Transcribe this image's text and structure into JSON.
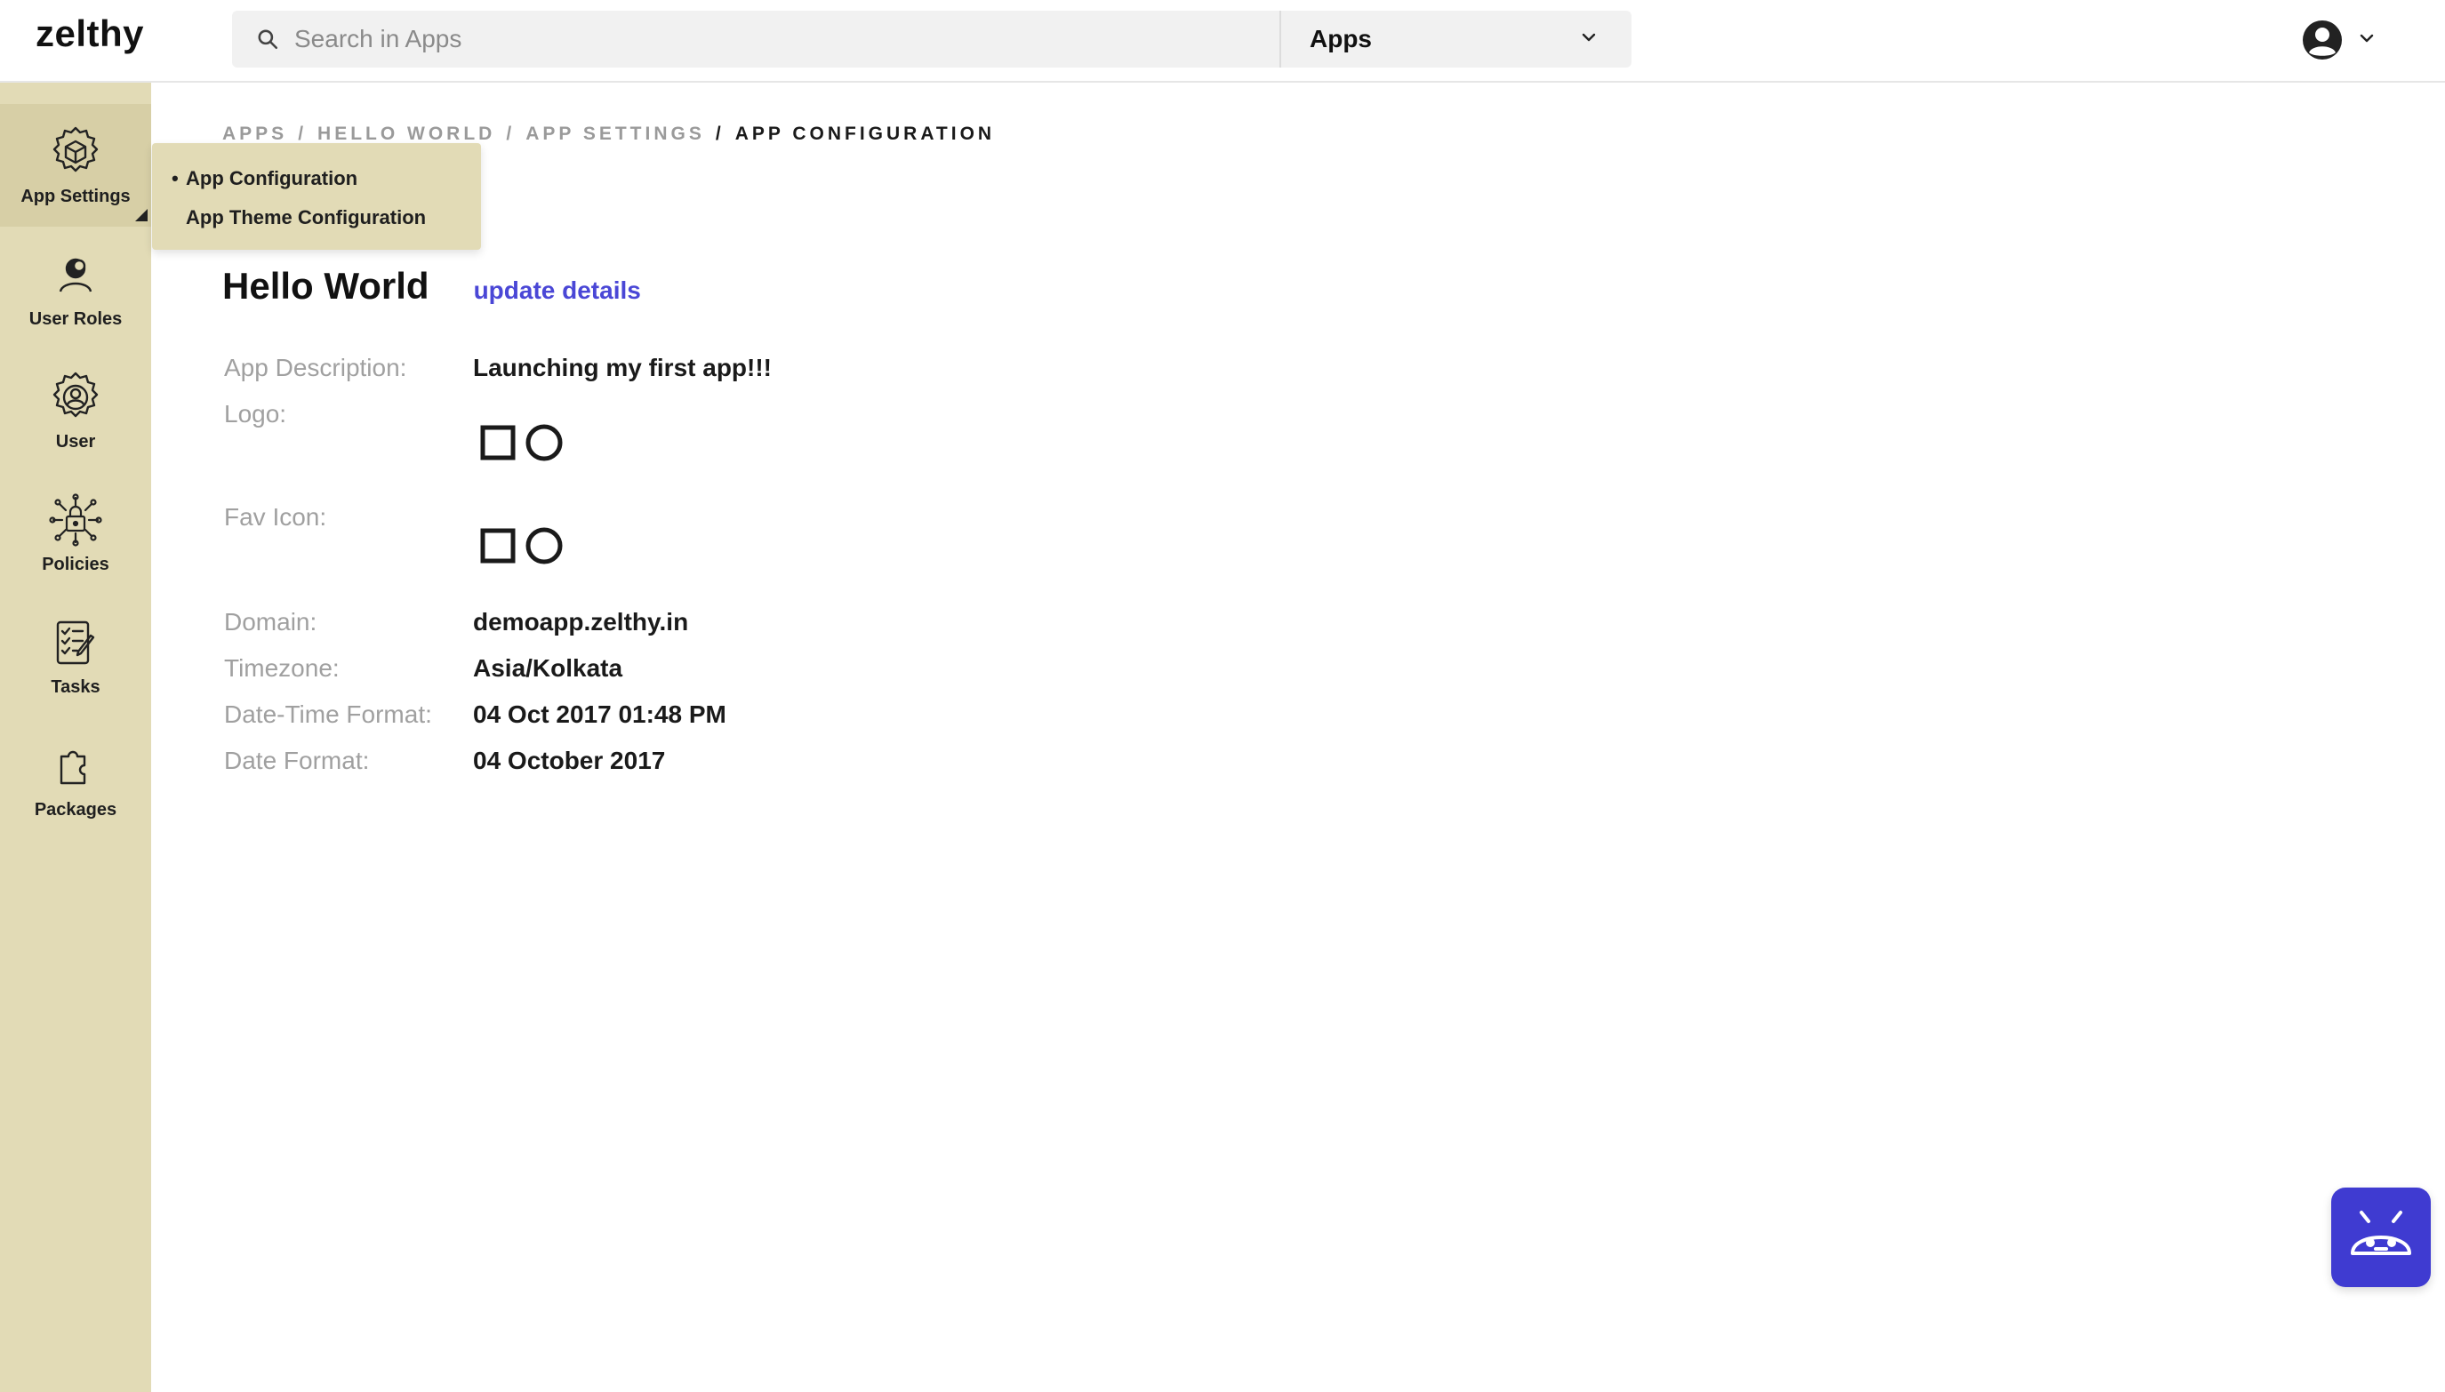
{
  "header": {
    "logo": "zelthy",
    "search": {
      "placeholder": "Search in Apps",
      "value": ""
    },
    "scope_select": {
      "selected": "Apps"
    }
  },
  "sidebar": {
    "items": [
      {
        "label": "App Settings",
        "icon": "cube-gear-icon",
        "active": true
      },
      {
        "label": "User Roles",
        "icon": "user-roles-icon"
      },
      {
        "label": "User",
        "icon": "gear-icon"
      },
      {
        "label": "Policies",
        "icon": "policy-lock-icon"
      },
      {
        "label": "Tasks",
        "icon": "checklist-icon"
      },
      {
        "label": "Packages",
        "icon": "puzzle-icon"
      }
    ]
  },
  "flyout": {
    "items": [
      {
        "label": "App Configuration",
        "active": true
      },
      {
        "label": "App Theme Configuration"
      }
    ]
  },
  "breadcrumb": {
    "items": [
      "APPS",
      "HELLO WORLD",
      "APP SETTINGS"
    ],
    "current": "APP CONFIGURATION",
    "separator": "/"
  },
  "page": {
    "title": "Hello World",
    "update_link": "update details"
  },
  "details": {
    "description_label": "App Description:",
    "description_value": "Launching my first app!!!",
    "logo_label": "Logo:",
    "favicon_label": "Fav Icon:",
    "domain_label": "Domain:",
    "domain_value": "demoapp.zelthy.in",
    "timezone_label": "Timezone:",
    "timezone_value": "Asia/Kolkata",
    "datetime_label": "Date-Time Format:",
    "datetime_value": "04 Oct 2017 01:48 PM",
    "date_label": "Date Format:",
    "date_value": "04 October 2017"
  },
  "colors": {
    "sidebar_bg": "#e2dbb6",
    "sidebar_active_bg": "#d7cfa6",
    "accent": "#4a47d6",
    "bot_button": "#3f3bd1"
  },
  "bot_button": {
    "icon": "robot-icon"
  }
}
